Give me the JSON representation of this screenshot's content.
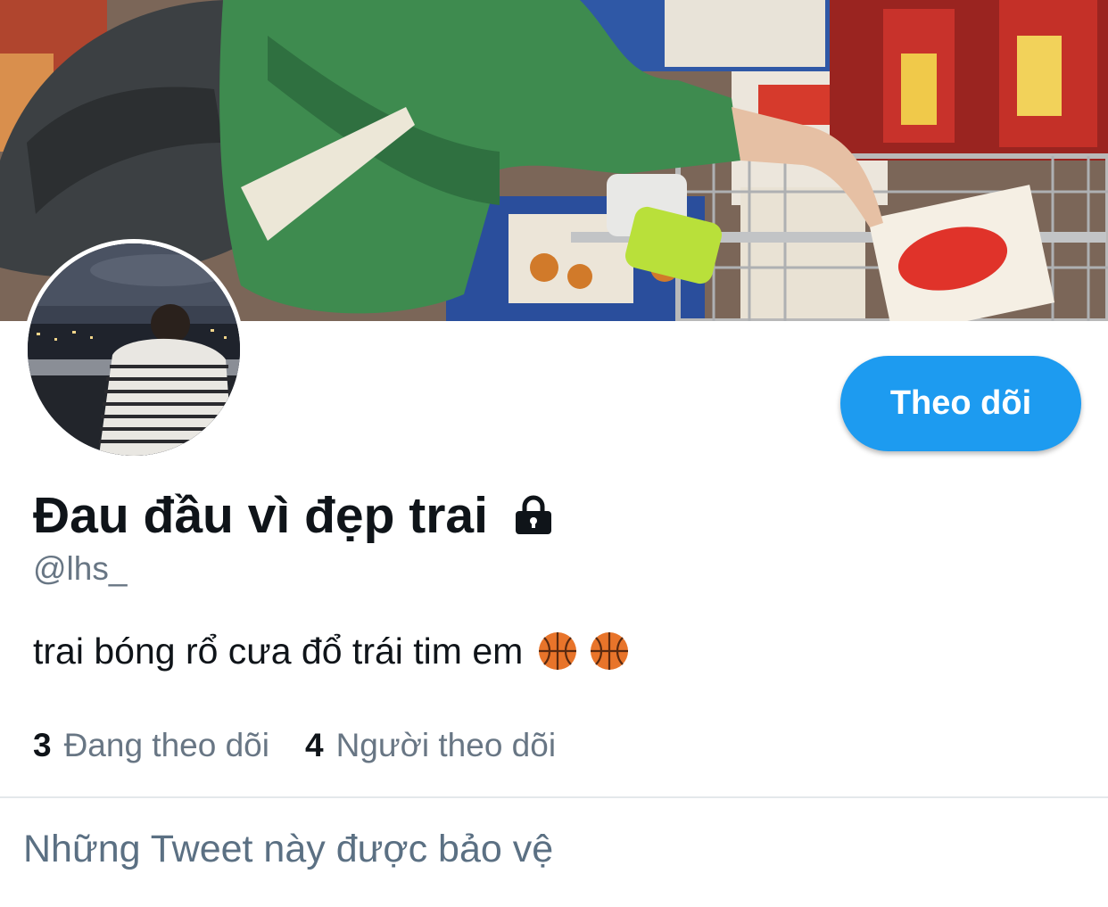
{
  "profile": {
    "display_name": "Đau đầu vì đẹp trai",
    "handle": "@lhs_",
    "bio": "trai bóng rổ cưa đổ trái tim em",
    "bio_emojis": [
      "basketball-icon",
      "basketball-icon"
    ],
    "protected": true
  },
  "actions": {
    "follow_label": "Theo dõi"
  },
  "stats": {
    "following_count": "3",
    "following_label": "Đang theo dõi",
    "followers_count": "4",
    "followers_label": "Người theo dõi"
  },
  "protected_notice": "Những Tweet này được bảo vệ",
  "colors": {
    "accent": "#1d9bf0",
    "text_primary": "#0f1419",
    "text_secondary": "#687684",
    "divider": "#e4e8eb"
  },
  "icons": {
    "lock": "lock-icon",
    "bio_emoji": "basketball-icon"
  }
}
